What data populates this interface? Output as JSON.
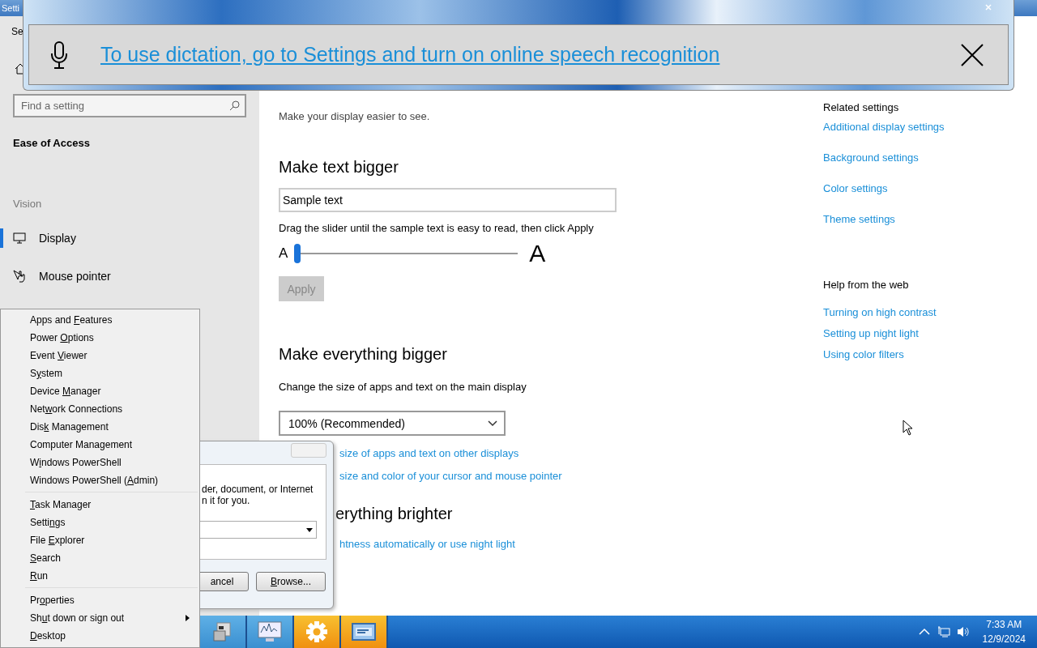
{
  "settings_window": {
    "title": "Setti",
    "app_title": "Se",
    "search": {
      "placeholder": "Find a setting"
    },
    "section": "Ease of Access",
    "group": "Vision",
    "nav": [
      {
        "label": "Display",
        "selected": true
      },
      {
        "label": "Mouse pointer",
        "selected": false
      }
    ],
    "subtitle": "Make your display easier to see.",
    "text_bigger": {
      "heading": "Make text bigger",
      "sample": "Sample text",
      "hint": "Drag the slider until the sample text is easy to read, then click Apply",
      "small_a": "A",
      "large_a": "A",
      "level": 0,
      "apply": {
        "label": "Apply",
        "disabled": true
      }
    },
    "everything_bigger": {
      "heading": "Make everything bigger",
      "hint": "Change the size of apps and text on the main display",
      "dropdown": "100% (Recommended)"
    },
    "partial_items": [
      {
        "kind": "link",
        "text": "size of apps and text on other displays"
      },
      {
        "kind": "link",
        "text": "size and color of your cursor and mouse pointer"
      },
      {
        "kind": "heading",
        "text": "erything brighter"
      },
      {
        "kind": "link",
        "text": "htness automatically or use night light"
      }
    ],
    "related": {
      "heading": "Related settings",
      "links": [
        "Additional display settings",
        "Background settings",
        "Color settings",
        "Theme settings"
      ]
    },
    "help": {
      "heading": "Help from the web",
      "links": [
        "Turning on high contrast",
        "Setting up night light",
        "Using color filters"
      ]
    }
  },
  "dictation": {
    "message": "To use dictation, go to Settings and turn on online speech recognition"
  },
  "run_dialog": {
    "lines": [
      "der, document, or Internet",
      "n it for you."
    ],
    "buttons": [
      {
        "after": "ancel"
      },
      {
        "key": "B",
        "after": "rowse..."
      }
    ]
  },
  "context_menu": {
    "groups": [
      [
        {
          "before": "Apps and ",
          "key": "F",
          "after": "eatures",
          "submenu": false
        },
        {
          "before": "Power ",
          "key": "O",
          "after": "ptions",
          "submenu": false
        },
        {
          "before": "Event ",
          "key": "V",
          "after": "iewer",
          "submenu": false
        },
        {
          "before": "S",
          "key": "y",
          "after": "stem",
          "submenu": false
        },
        {
          "before": "Device ",
          "key": "M",
          "after": "anager",
          "submenu": false
        },
        {
          "before": "Net",
          "key": "w",
          "after": "ork Connections",
          "submenu": false
        },
        {
          "before": "Dis",
          "key": "k",
          "after": " Management",
          "submenu": false
        },
        {
          "before": "Computer Mana",
          "key": "g",
          "after": "ement",
          "submenu": false
        },
        {
          "before": "W",
          "key": "i",
          "after": "ndows PowerShell",
          "submenu": false
        },
        {
          "before": "Windows PowerShell (",
          "key": "A",
          "after": "dmin)",
          "submenu": false
        }
      ],
      [
        {
          "key": "T",
          "after": "ask Manager",
          "submenu": false
        },
        {
          "before": "Setti",
          "key": "n",
          "after": "gs",
          "submenu": false
        },
        {
          "before": "File ",
          "key": "E",
          "after": "xplorer",
          "submenu": false
        },
        {
          "key": "S",
          "after": "earch",
          "submenu": false
        },
        {
          "key": "R",
          "after": "un",
          "submenu": false
        }
      ],
      [
        {
          "before": "Pr",
          "key": "o",
          "after": "perties",
          "submenu": false
        },
        {
          "before": "Sh",
          "key": "u",
          "after": "t down or sign out",
          "submenu": true
        },
        {
          "key": "D",
          "after": "esktop",
          "submenu": false
        }
      ]
    ]
  },
  "taskbar": {
    "apps": [
      {
        "kind": "blue"
      },
      {
        "kind": "blue"
      },
      {
        "kind": "orange"
      },
      {
        "kind": "orange"
      }
    ],
    "time": "7:33 AM",
    "date": "12/9/2024"
  }
}
